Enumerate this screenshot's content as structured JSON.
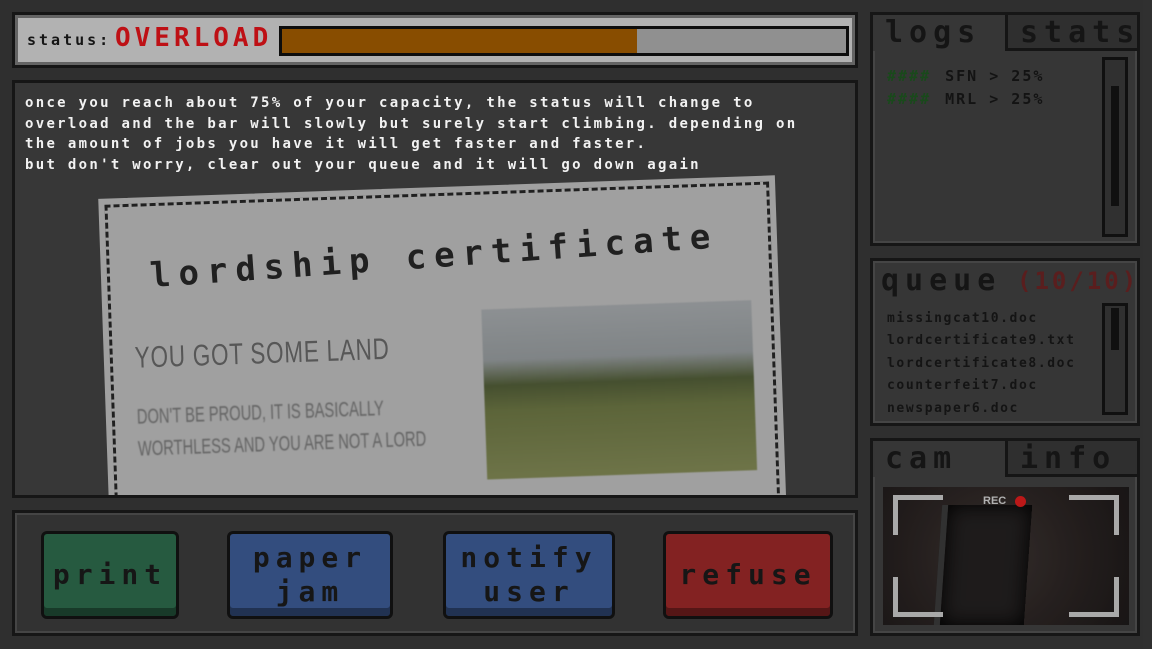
{
  "status": {
    "label": "STATUS:",
    "value": "OVERLOAD",
    "bar_fill_percent": 63,
    "bar_color": "#a65f00",
    "value_color": "#e8141a"
  },
  "tutorial": {
    "lines": [
      "ONCE YOU REACH ABOUT 75% OF YOUR CAPACITY, THE STATUS WILL CHANGE TO",
      "OVERLOAD AND THE BAR WILL SLOWLY BUT SURELY START CLIMBING. DEPENDING ON",
      "THE AMOUNT OF JOBS YOU HAVE IT WILL GET FASTER AND FASTER.",
      "BUT DON'T WORRY, CLEAR OUT YOUR QUEUE AND IT WILL GO DOWN AGAIN"
    ]
  },
  "document": {
    "title": "LORDSHIP CERTIFICATE",
    "heading": "YOU GOT SOME LAND",
    "subtext": "DON'T BE PROUD, IT IS BASICALLY WORTHLESS AND YOU ARE NOT A LORD"
  },
  "buttons": {
    "print": "PRINT",
    "paper_jam": "PAPER\nJAM",
    "notify_user": "NOTIFY\nUSER",
    "refuse": "REFUSE"
  },
  "logs_panel": {
    "tab_logs": "LOGS",
    "tab_stats": "STATS",
    "entries": [
      {
        "prefix": "####",
        "text": "SFN > 25%"
      },
      {
        "prefix": "####",
        "text": "MRL > 25%"
      }
    ]
  },
  "queue": {
    "title": "QUEUE",
    "count": "(10/10)",
    "items": [
      "MISSINGCAT10.DOC",
      "LORDCERTIFICATE9.TXT",
      "LORDCERTIFICATE8.DOC",
      "COUNTERFEIT7.DOC",
      "NEWSPAPER6.DOC"
    ]
  },
  "cam_panel": {
    "tab_cam": "CAM",
    "tab_info": "INFO",
    "rec_label": "REC",
    "rec_dot_color": "#e61e1e"
  }
}
